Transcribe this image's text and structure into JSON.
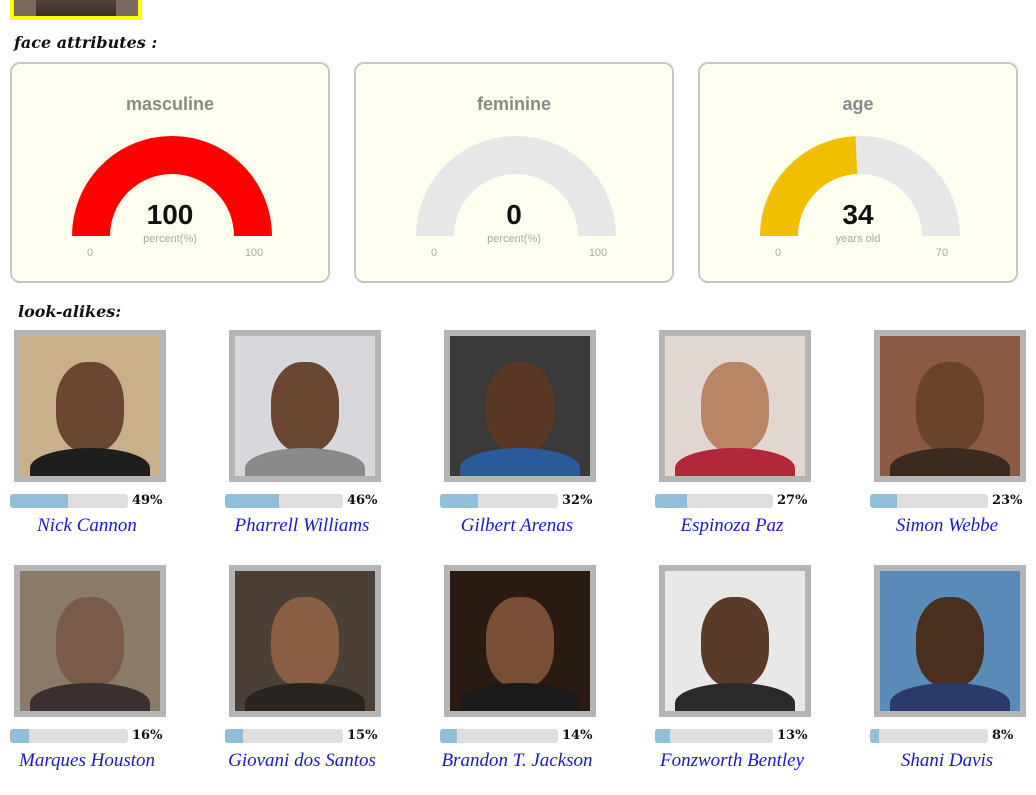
{
  "sections": {
    "attributes_title": "face attributes :",
    "lookalikes_title": "look-alikes:"
  },
  "gauges": [
    {
      "title": "masculine",
      "value": "100",
      "unit": "percent(%)",
      "min": "0",
      "max": "100",
      "fraction": 1.0,
      "color": "#ff0000"
    },
    {
      "title": "feminine",
      "value": "0",
      "unit": "percent(%)",
      "min": "0",
      "max": "100",
      "fraction": 0.0,
      "color": "#ff0000"
    },
    {
      "title": "age",
      "value": "34",
      "unit": "years old",
      "min": "0",
      "max": "70",
      "fraction": 0.4857,
      "color": "#f0c000"
    }
  ],
  "gauge_track_color": "#e8e6e6",
  "lookalikes": [
    {
      "name": "Nick Cannon",
      "percent": "49%",
      "score": 49
    },
    {
      "name": "Pharrell Williams",
      "percent": "46%",
      "score": 46
    },
    {
      "name": "Gilbert Arenas",
      "percent": "32%",
      "score": 32
    },
    {
      "name": "Espinoza Paz",
      "percent": "27%",
      "score": 27
    },
    {
      "name": "Simon Webbe",
      "percent": "23%",
      "score": 23
    },
    {
      "name": "Marques Houston",
      "percent": "16%",
      "score": 16
    },
    {
      "name": "Giovani dos Santos",
      "percent": "15%",
      "score": 15
    },
    {
      "name": "Brandon T. Jackson",
      "percent": "14%",
      "score": 14
    },
    {
      "name": "Fonzworth Bentley",
      "percent": "13%",
      "score": 13
    },
    {
      "name": "Shani Davis",
      "percent": "8%",
      "score": 8
    }
  ],
  "colors": {
    "bar_fill": "#8fbfd9",
    "bar_track": "#dedede",
    "name_link": "#1a1acc",
    "highlight_border": "#ffff00"
  }
}
